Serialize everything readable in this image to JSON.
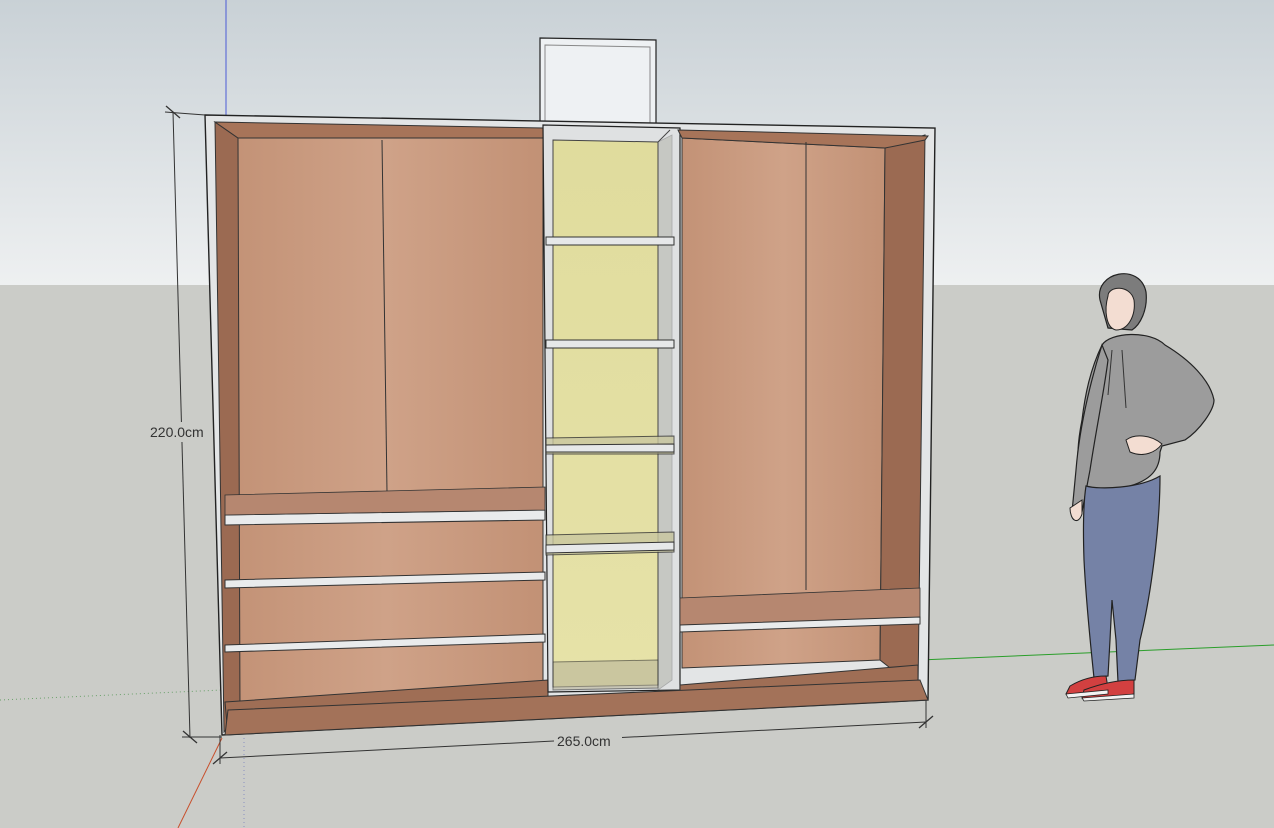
{
  "viewport": {
    "sky_color": "#e9ecee",
    "sky_top_color": "#cfd6db",
    "ground_color": "#cbccc8"
  },
  "dimensions": {
    "height_label": "220.0cm",
    "width_label": "265.0cm"
  },
  "model": {
    "frame_color": "#e3e5e6",
    "wood_back_color": "#c99a80",
    "wood_side_color": "#9b6a52",
    "shelf_color": "#e4e6e7",
    "center_back_color": "#e3dfa0"
  },
  "axes": {
    "blue_axis_color": "#4b5bd6",
    "green_axis_color": "#2a9e2a",
    "red_axis_color": "#c8502d"
  }
}
